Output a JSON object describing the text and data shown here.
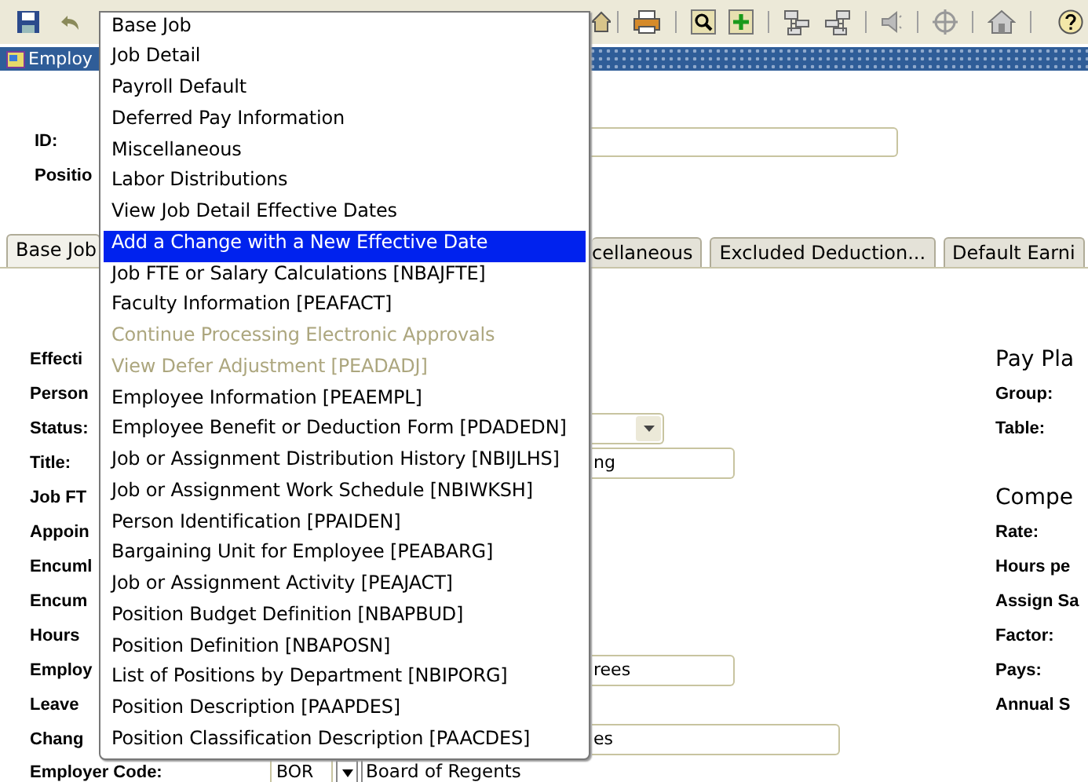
{
  "window": {
    "title": "Employ"
  },
  "key_block": {
    "labels": [
      "ID:",
      "Positio"
    ]
  },
  "tabs": [
    {
      "label": "Base Job",
      "selected": true
    },
    {
      "label": "cellaneous",
      "selected": false
    },
    {
      "label": "Excluded Deduction...",
      "selected": false
    },
    {
      "label": "Default Earni",
      "selected": false
    }
  ],
  "form": {
    "rows": [
      {
        "label": "Effecti"
      },
      {
        "label": "Person"
      },
      {
        "label": "Status:",
        "field": {
          "kind": "dropdown"
        }
      },
      {
        "label": "Title:",
        "field": {
          "kind": "text",
          "value": "ng"
        }
      },
      {
        "label": "Job FT"
      },
      {
        "label": "Appoin"
      },
      {
        "label": "Encuml"
      },
      {
        "label": "Encum"
      },
      {
        "label": "Hours"
      },
      {
        "label": "Employ",
        "field": {
          "kind": "text",
          "value": "rees"
        }
      },
      {
        "label": "Leave"
      },
      {
        "label": "Chang",
        "field": {
          "kind": "wide",
          "value": "es"
        }
      }
    ],
    "employer_code": {
      "label": "Employer Code:",
      "code": "BOR",
      "description": "Board of Regents"
    },
    "right_sections": [
      {
        "heading": "Pay Pla",
        "labels": [
          "Group:",
          "Table:"
        ]
      },
      {
        "heading": "Compe",
        "labels": [
          "Rate:",
          "Hours pe",
          "Assign Sa",
          "Factor:",
          "Pays:",
          "Annual S"
        ]
      }
    ]
  },
  "menu": {
    "items": [
      {
        "label": "Base Job",
        "selected": false,
        "disabled": false
      },
      {
        "label": "Job Detail",
        "selected": false,
        "disabled": false
      },
      {
        "label": "Payroll Default",
        "selected": false,
        "disabled": false
      },
      {
        "label": "Deferred Pay Information",
        "selected": false,
        "disabled": false
      },
      {
        "label": "Miscellaneous",
        "selected": false,
        "disabled": false
      },
      {
        "label": "Labor Distributions",
        "selected": false,
        "disabled": false
      },
      {
        "label": "View Job Detail Effective Dates",
        "selected": false,
        "disabled": false
      },
      {
        "label": "Add a Change with a New Effective Date",
        "selected": true,
        "disabled": false
      },
      {
        "label": "Job FTE or Salary Calculations [NBAJFTE]",
        "selected": false,
        "disabled": false
      },
      {
        "label": "Faculty Information [PEAFACT]",
        "selected": false,
        "disabled": false
      },
      {
        "label": "Continue Processing Electronic Approvals",
        "selected": false,
        "disabled": true
      },
      {
        "label": "View Defer Adjustment [PEADADJ]",
        "selected": false,
        "disabled": true
      },
      {
        "label": "Employee Information [PEAEMPL]",
        "selected": false,
        "disabled": false
      },
      {
        "label": "Employee Benefit or Deduction Form [PDADEDN]",
        "selected": false,
        "disabled": false
      },
      {
        "label": "Job or Assignment Distribution History [NBIJLHS]",
        "selected": false,
        "disabled": false
      },
      {
        "label": "Job or Assignment Work Schedule [NBIWKSH]",
        "selected": false,
        "disabled": false
      },
      {
        "label": "Person Identification [PPAIDEN]",
        "selected": false,
        "disabled": false
      },
      {
        "label": "Bargaining Unit for Employee [PEABARG]",
        "selected": false,
        "disabled": false
      },
      {
        "label": "Job or Assignment Activity [PEAJACT]",
        "selected": false,
        "disabled": false
      },
      {
        "label": "Position Budget Definition [NBAPBUD]",
        "selected": false,
        "disabled": false
      },
      {
        "label": "Position Definition [NBAPOSN]",
        "selected": false,
        "disabled": false
      },
      {
        "label": "List of Positions by Department [NBIPORG]",
        "selected": false,
        "disabled": false
      },
      {
        "label": "Position Description [PAAPDES]",
        "selected": false,
        "disabled": false
      },
      {
        "label": "Position Classification Description [PAACDES]",
        "selected": false,
        "disabled": false
      }
    ]
  }
}
